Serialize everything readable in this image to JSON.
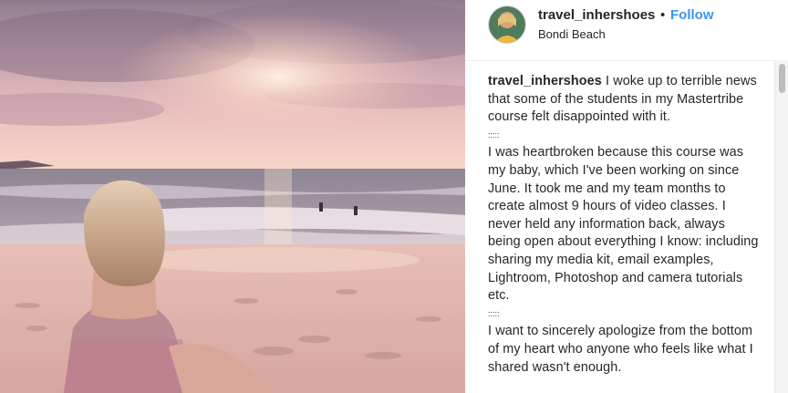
{
  "post": {
    "username": "travel_inhershoes",
    "separator": "•",
    "follow_label": "Follow",
    "location": "Bondi Beach"
  },
  "caption": {
    "username": "travel_inhershoes",
    "para1": "I woke up to terrible news that some of the students in my Mastertribe course felt disappointed with it.",
    "sep1": ":::::",
    "para2": "I was heartbroken because this course was my baby, which I've been working on since June. It took me and my team months to create almost 9 hours of video classes. I never held any information back, always being open about everything I know: including sharing my media kit, email examples, Lightroom, Photoshop and camera tutorials etc.",
    "sep2": ":::::",
    "para3": "I want to sincerely apologize from the bottom of my heart who anyone who feels like what I shared wasn't enough."
  },
  "icons": {
    "photo": "beach-sunset-photo",
    "avatar": "avatar-photo"
  },
  "colors": {
    "follow": "#3897f0",
    "text": "#262626"
  }
}
